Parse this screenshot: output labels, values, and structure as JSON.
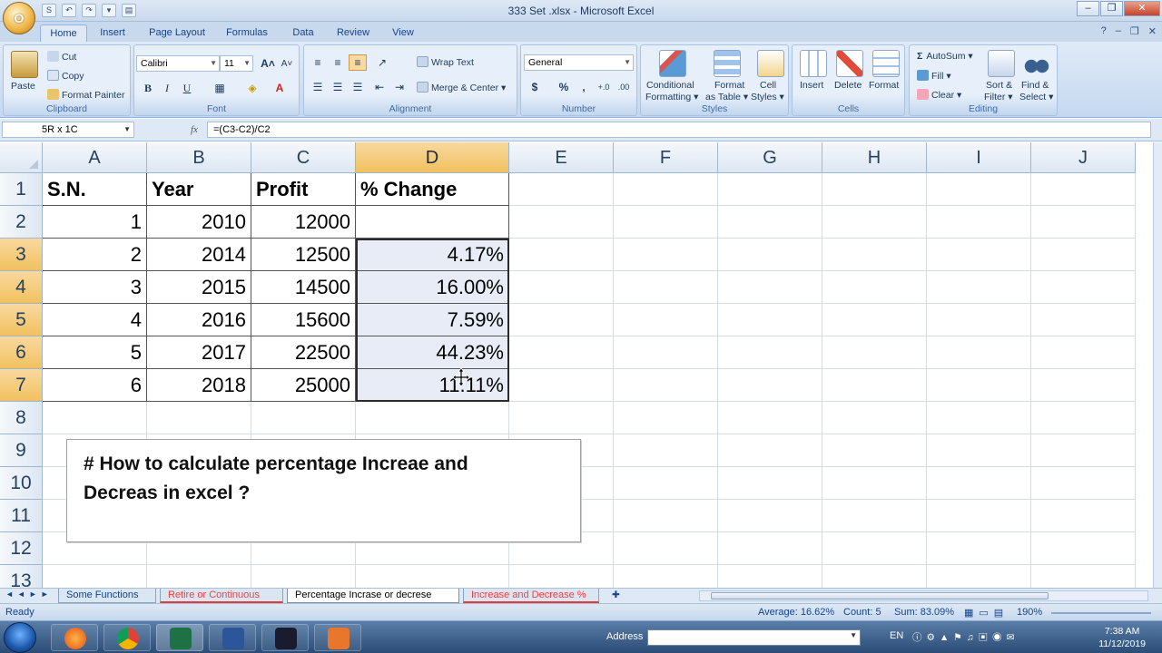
{
  "window": {
    "title": "333 Set .xlsx - Microsoft Excel",
    "minimize": "–",
    "restore": "❐",
    "close": "✕"
  },
  "office_button": "O",
  "qat": [
    "S",
    "↶",
    "↷",
    "▾",
    "▤"
  ],
  "tabs": [
    "Home",
    "Insert",
    "Page Layout",
    "Formulas",
    "Data",
    "Review",
    "View"
  ],
  "ribbon": {
    "clipboard": {
      "label": "Clipboard",
      "paste": "Paste",
      "cut": "Cut",
      "copy": "Copy",
      "format_painter": "Format Painter"
    },
    "font": {
      "label": "Font",
      "name": "Calibri",
      "size": "11",
      "bold": "B",
      "italic": "I",
      "underline": "U",
      "grow": "A˄",
      "shrink": "A˅",
      "font_color": "A"
    },
    "alignment": {
      "label": "Alignment",
      "wrap_text": "Wrap Text",
      "merge_center": "Merge & Center"
    },
    "number": {
      "label": "Number",
      "format": "General",
      "currency": "$",
      "percent": "%",
      "comma": ",",
      "inc_decimal": "+.0",
      "dec_decimal": ".00"
    },
    "styles": {
      "label": "Styles",
      "conditional_1": "Conditional",
      "conditional_2": "Formatting ▾",
      "table_1": "Format",
      "table_2": "as Table ▾",
      "cell_1": "Cell",
      "cell_2": "Styles ▾"
    },
    "cells": {
      "label": "Cells",
      "insert": "Insert",
      "delete": "Delete",
      "format": "Format"
    },
    "editing": {
      "label": "Editing",
      "autosum": "AutoSum ▾",
      "fill": "Fill ▾",
      "clear": "Clear ▾",
      "sort_1": "Sort &",
      "sort_2": "Filter ▾",
      "find_1": "Find &",
      "find_2": "Select ▾"
    }
  },
  "formula_bar": {
    "name_box": "5R x 1C",
    "fx": "fx",
    "formula": "=(C3-C2)/C2"
  },
  "columns": [
    "A",
    "B",
    "C",
    "D",
    "E",
    "F",
    "G",
    "H",
    "I",
    "J"
  ],
  "rows": [
    "1",
    "2",
    "3",
    "4",
    "5",
    "6",
    "7",
    "8",
    "9",
    "10",
    "11",
    "12",
    "13"
  ],
  "table": {
    "headers": [
      "S.N.",
      "Year",
      "Profit",
      "% Change"
    ],
    "rows": [
      [
        "1",
        "2010",
        "12000",
        ""
      ],
      [
        "2",
        "2014",
        "12500",
        "4.17%"
      ],
      [
        "3",
        "2015",
        "14500",
        "16.00%"
      ],
      [
        "4",
        "2016",
        "15600",
        "7.59%"
      ],
      [
        "5",
        "2017",
        "22500",
        "44.23%"
      ],
      [
        "6",
        "2018",
        "25000",
        "11.11%"
      ]
    ]
  },
  "textbox": {
    "line1": "# How to calculate percentage Increae and",
    "line2": "Decreas in excel ?"
  },
  "sheets": [
    {
      "name": "Some Functions",
      "style": "normal"
    },
    {
      "name": "Retire or Continuous",
      "style": "red"
    },
    {
      "name": "Percentage Incrase or decrese",
      "style": "active"
    },
    {
      "name": "Increase and Decrease %",
      "style": "red"
    }
  ],
  "status": {
    "ready": "Ready",
    "average": "Average: 16.62%",
    "count": "Count: 5",
    "sum": "Sum: 83.09%",
    "zoom": "190%"
  },
  "taskbar": {
    "address_label": "Address",
    "lang": "EN",
    "time": "7:38 AM",
    "date": "11/12/2019"
  },
  "colors": {
    "ribbon_bg": "#dfeaf7",
    "selected_header": "#f1c15f",
    "selection_fill": "#e8ecf6",
    "red_tab": "#ff3b3b"
  }
}
